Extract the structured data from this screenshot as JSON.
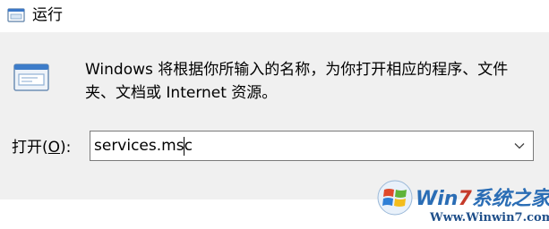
{
  "window": {
    "title": "运行",
    "icon": "run-dialog-icon"
  },
  "main": {
    "description": "Windows 将根据你所输入的名称，为你打开相应的程序、文件夹、文档或 Internet 资源。",
    "open_label": "打开(",
    "open_mnemonic": "O",
    "open_label_suffix": "):",
    "command_value": "services.msc",
    "dropdown_icon": "chevron-down-icon"
  },
  "watermark": {
    "title_prefix": "Win",
    "title_seven": "7",
    "title_suffix": "系统之家",
    "url": "Www.Winwin7.com"
  }
}
